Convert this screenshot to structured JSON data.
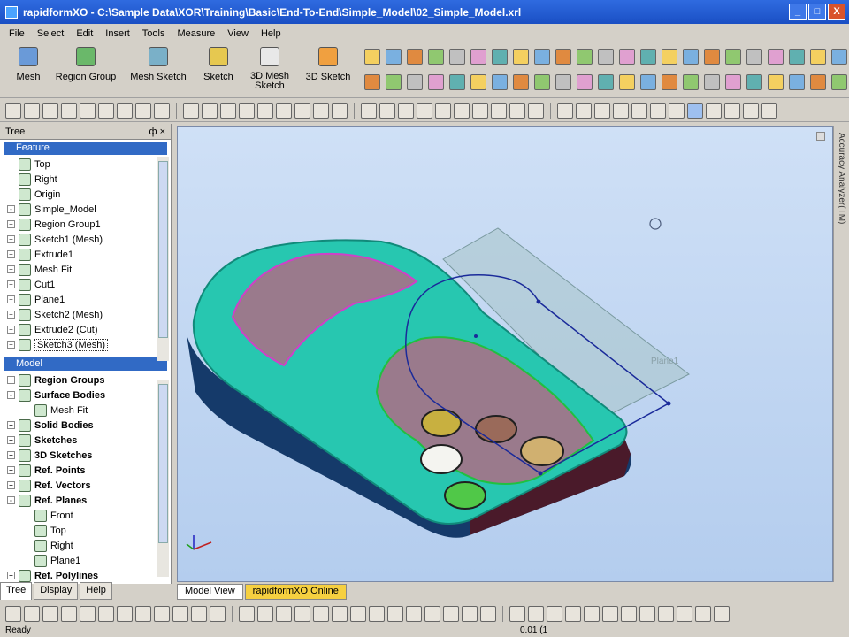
{
  "window": {
    "title": "rapidformXO - C:\\Sample Data\\XOR\\Training\\Basic\\End-To-End\\Simple_Model\\02_Simple_Model.xrl",
    "min": "_",
    "max": "□",
    "close": "X"
  },
  "menu": [
    "File",
    "Select",
    "Edit",
    "Insert",
    "Tools",
    "Measure",
    "View",
    "Help"
  ],
  "ribbon_big": [
    {
      "label": "Mesh"
    },
    {
      "label": "Region Group"
    },
    {
      "label": "Mesh Sketch"
    },
    {
      "label": "Sketch"
    },
    {
      "label": "3D Mesh Sketch"
    },
    {
      "label": "3D Sketch"
    }
  ],
  "tree_panel": {
    "title": "Tree",
    "pin": "ф",
    "close": "×",
    "feature_section": "Feature",
    "feature_items": [
      {
        "label": "Top",
        "exp": ""
      },
      {
        "label": "Right",
        "exp": ""
      },
      {
        "label": "Origin",
        "exp": ""
      },
      {
        "label": "Simple_Model",
        "exp": "-"
      },
      {
        "label": "Region Group1",
        "exp": "+"
      },
      {
        "label": "Sketch1 (Mesh)",
        "exp": "+"
      },
      {
        "label": "Extrude1",
        "exp": "+"
      },
      {
        "label": "Mesh Fit",
        "exp": "+"
      },
      {
        "label": "Cut1",
        "exp": "+"
      },
      {
        "label": "Plane1",
        "exp": "+"
      },
      {
        "label": "Sketch2 (Mesh)",
        "exp": "+"
      },
      {
        "label": "Extrude2 (Cut)",
        "exp": "+"
      },
      {
        "label": "Sketch3 (Mesh)",
        "exp": "+"
      }
    ],
    "model_section": "Model",
    "model_items": [
      {
        "label": "Region Groups",
        "exp": "+",
        "bold": true
      },
      {
        "label": "Surface Bodies",
        "exp": "-",
        "bold": true
      },
      {
        "label": "Mesh Fit",
        "exp": "",
        "bold": false
      },
      {
        "label": "Solid Bodies",
        "exp": "+",
        "bold": true
      },
      {
        "label": "Sketches",
        "exp": "+",
        "bold": true
      },
      {
        "label": "3D Sketches",
        "exp": "+",
        "bold": true
      },
      {
        "label": "Ref. Points",
        "exp": "+",
        "bold": true
      },
      {
        "label": "Ref. Vectors",
        "exp": "+",
        "bold": true
      },
      {
        "label": "Ref. Planes",
        "exp": "-",
        "bold": true
      },
      {
        "label": "Front",
        "exp": "",
        "bold": false
      },
      {
        "label": "Top",
        "exp": "",
        "bold": false
      },
      {
        "label": "Right",
        "exp": "",
        "bold": false
      },
      {
        "label": "Plane1",
        "exp": "",
        "bold": false
      },
      {
        "label": "Ref. Polylines",
        "exp": "+",
        "bold": true
      }
    ]
  },
  "bottom_tabs": [
    "Tree",
    "Display",
    "Help"
  ],
  "view_tabs": [
    "Model View",
    "rapidformXO Online"
  ],
  "right_strip": "Accuracy Analyzer(TM)",
  "viewport": {
    "plane_label": "Plane1"
  },
  "status": {
    "text": "Ready",
    "coord": "0.01 (1"
  },
  "colors": {
    "model_teal": "#27c7b0",
    "model_dark_side": "#153a6a",
    "model_dark_side2": "#4a1a2a",
    "pocket_purple": "#9a7a8c",
    "sketch_blue": "#1a2a9a",
    "viewport_bg": "#c2d6f2"
  }
}
